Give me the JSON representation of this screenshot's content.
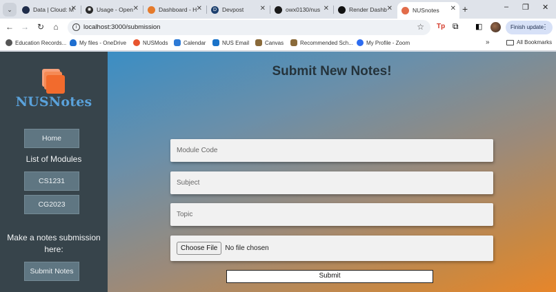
{
  "browser": {
    "tabs": [
      {
        "title": "Data | Cloud: M",
        "icon_color": "#1f2d4a"
      },
      {
        "title": "Usage - Open",
        "icon_color": "#2a2a2a"
      },
      {
        "title": "Dashboard - H",
        "icon_color": "#e57a2b"
      },
      {
        "title": "Devpost",
        "icon_color": "#1c3f6e"
      },
      {
        "title": "owx0130/nus",
        "icon_color": "#1a1a1a"
      },
      {
        "title": "Render Dashb",
        "icon_color": "#111111"
      },
      {
        "title": "NUSnotes",
        "icon_color": "#e26c4a",
        "active": true
      }
    ],
    "new_tab": "+",
    "window_controls": {
      "minimize": "–",
      "restore": "❐",
      "close": "✕"
    },
    "nav": {
      "back": "←",
      "forward": "→",
      "reload": "↻",
      "home": "⌂"
    },
    "url": "localhost:3000/submission",
    "finish_update": "Finish update",
    "bookmarks": [
      {
        "label": "Education Records...",
        "icon_color": "#555555"
      },
      {
        "label": "My files - OneDrive",
        "icon_color": "#1f6fd0"
      },
      {
        "label": "NUSMods",
        "icon_color": "#e8552f"
      },
      {
        "label": "Calendar",
        "icon_color": "#2e7bd6"
      },
      {
        "label": "NUS Email",
        "icon_color": "#1a73c9"
      },
      {
        "label": "Canvas",
        "icon_color": "#8a6a3a"
      },
      {
        "label": "Recommended Sch...",
        "icon_color": "#8a6a3a"
      },
      {
        "label": "My Profile - Zoom",
        "icon_color": "#2d6cf0"
      }
    ],
    "bookmarks_more": "»",
    "all_bookmarks": "All Bookmarks"
  },
  "sidebar": {
    "logo_text": "NUSNotes",
    "home_label": "Home",
    "modules_heading": "List of Modules",
    "modules": [
      "CS1231",
      "CG2023"
    ],
    "submission_prompt_line1": "Make a notes submission",
    "submission_prompt_line2": "here:",
    "submit_notes_label": "Submit Notes"
  },
  "form": {
    "title": "Submit New Notes!",
    "module_code_placeholder": "Module Code",
    "subject_placeholder": "Subject",
    "topic_placeholder": "Topic",
    "choose_file_label": "Choose File",
    "file_status": "No file chosen",
    "submit_label": "Submit"
  },
  "colors": {
    "sidebar_bg": "#37444b",
    "logo_blue": "#5aa2db",
    "logo_orange": "#f26b2d",
    "gradient_start": "#3b8ec4",
    "gradient_end": "#e7862a"
  }
}
